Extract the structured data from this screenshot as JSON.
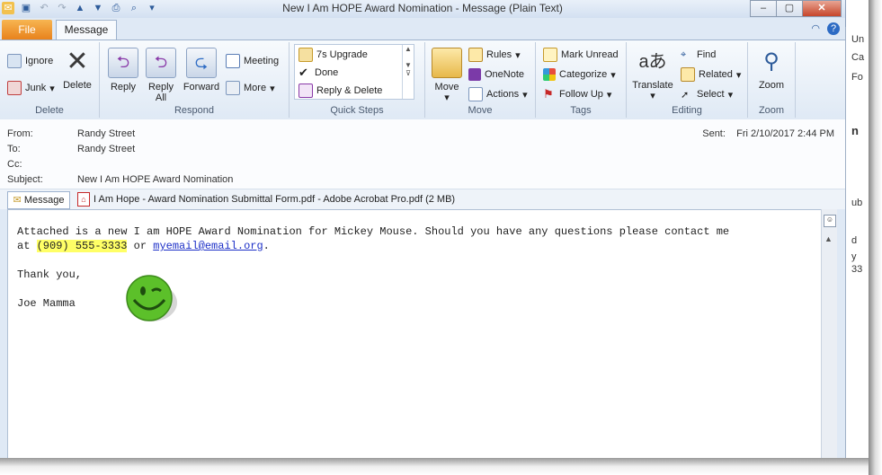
{
  "window": {
    "title": "New I Am HOPE Award Nomination  -  Message (Plain Text)"
  },
  "tabs": {
    "file": "File",
    "message": "Message"
  },
  "ribbon": {
    "delete_group": {
      "label": "Delete",
      "ignore": "Ignore",
      "junk": "Junk",
      "delete": "Delete"
    },
    "respond_group": {
      "label": "Respond",
      "reply": "Reply",
      "reply_all_1": "Reply",
      "reply_all_2": "All",
      "forward": "Forward",
      "meeting": "Meeting",
      "more": "More"
    },
    "quick_steps": {
      "label": "Quick Steps",
      "items": [
        "7s Upgrade",
        "Done",
        "Reply & Delete"
      ]
    },
    "move_group": {
      "label": "Move",
      "move": "Move",
      "rules": "Rules",
      "onenote": "OneNote",
      "actions": "Actions"
    },
    "tags_group": {
      "label": "Tags",
      "mark_unread": "Mark Unread",
      "categorize": "Categorize",
      "follow_up": "Follow Up"
    },
    "editing_group": {
      "label": "Editing",
      "translate": "Translate",
      "find": "Find",
      "related": "Related",
      "select": "Select"
    },
    "zoom_group": {
      "label": "Zoom",
      "zoom": "Zoom"
    }
  },
  "header": {
    "from_label": "From:",
    "from": "Randy Street",
    "to_label": "To:",
    "to": "Randy Street",
    "cc_label": "Cc:",
    "subject_label": "Subject:",
    "subject": "New I Am HOPE Award Nomination",
    "sent_label": "Sent:",
    "sent": "Fri 2/10/2017 2:44 PM"
  },
  "attachments": {
    "message_tab": "Message",
    "file": "I Am Hope - Award Nomination Submittal Form.pdf - Adobe Acrobat Pro.pdf (2 MB)"
  },
  "body": {
    "line1": "Attached is a new I am HOPE Award Nomination for Mickey Mouse. Should you have any questions please contact me",
    "line2_prefix": "at ",
    "phone": "(909) 555-3333",
    "or": " or ",
    "email": "myemail@email.org",
    "period": ".",
    "thanks": "Thank you,",
    "signature": "Joe Mamma"
  },
  "background_window": {
    "lines": [
      "Un",
      "Ca",
      "Fo",
      "n",
      "ub",
      "d",
      "y",
      "33"
    ]
  },
  "colors": {
    "file_tab": "#e8821c",
    "highlight": "#ffff66",
    "link": "#1c2fc7",
    "smiley": "#5cc02a"
  }
}
